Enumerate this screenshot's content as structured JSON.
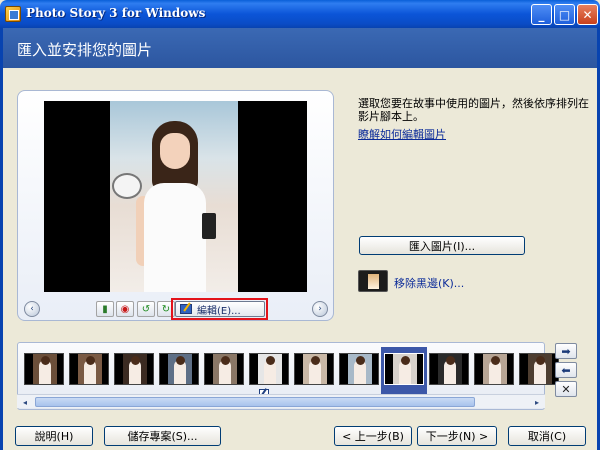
{
  "window": {
    "title": "Photo Story 3 for Windows",
    "minimize": "_",
    "maximize": "□",
    "close": "✕"
  },
  "header": {
    "title": "匯入並安排您的圖片"
  },
  "preview": {
    "prev_glyph": "‹",
    "next_glyph": "›",
    "tools": {
      "levels_glyph": "▮",
      "redeye_glyph": "◉",
      "rotate_left_glyph": "↺",
      "rotate_right_glyph": "↻"
    },
    "edit_label": "編輯(E)..."
  },
  "right_panel": {
    "instruction": "選取您要在故事中使用的圖片，然後依序排列在影片腳本上。",
    "learn_link": "瞭解如何編輯圖片",
    "import_button": "匯入圖片(I)...",
    "remove_link": "移除黑邊(K)..."
  },
  "filmstrip": {
    "thumbnail_count": 12,
    "selected_index": 8,
    "edited_index": 5,
    "side_buttons": {
      "move_right": "➡",
      "move_left": "⬅",
      "delete": "✕"
    },
    "scroll_left": "◂",
    "scroll_right": "▸"
  },
  "footer": {
    "help": "說明(H)",
    "save": "儲存專案(S)...",
    "back": "< 上一步(B)",
    "next": "下一步(N) >",
    "cancel": "取消(C)"
  },
  "colors": {
    "titlebar": "#0a4cc6",
    "header": "#3b69b4",
    "highlight": "#e3131b",
    "selected": "#3c57a8",
    "link": "#0b2b99"
  }
}
